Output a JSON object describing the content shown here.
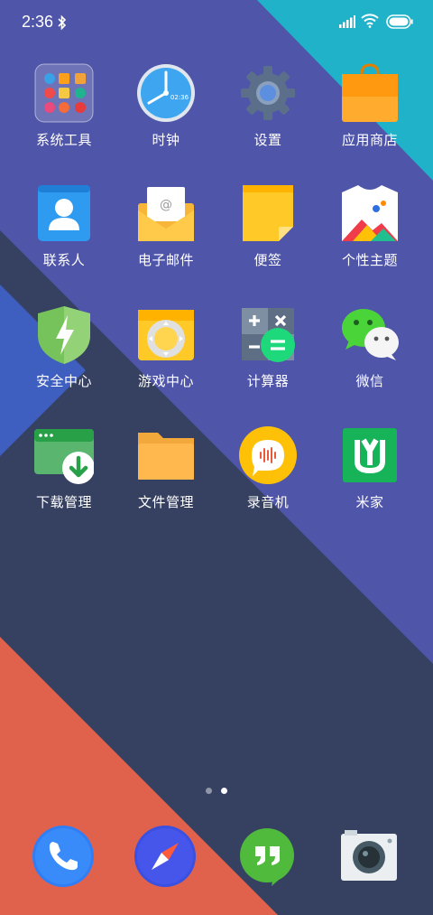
{
  "status_bar": {
    "time": "2:36"
  },
  "apps": [
    {
      "id": "system-tools",
      "label": "系统工具"
    },
    {
      "id": "clock",
      "label": "时钟",
      "clock_text": "02:36"
    },
    {
      "id": "settings",
      "label": "设置"
    },
    {
      "id": "app-store",
      "label": "应用商店"
    },
    {
      "id": "contacts",
      "label": "联系人"
    },
    {
      "id": "email",
      "label": "电子邮件"
    },
    {
      "id": "notes",
      "label": "便签"
    },
    {
      "id": "themes",
      "label": "个性主题"
    },
    {
      "id": "security",
      "label": "安全中心"
    },
    {
      "id": "game-center",
      "label": "游戏中心"
    },
    {
      "id": "calculator",
      "label": "计算器"
    },
    {
      "id": "wechat",
      "label": "微信"
    },
    {
      "id": "downloads",
      "label": "下载管理"
    },
    {
      "id": "file-manager",
      "label": "文件管理"
    },
    {
      "id": "recorder",
      "label": "录音机"
    },
    {
      "id": "mijia",
      "label": "米家"
    }
  ],
  "page_indicator": {
    "pages": 2,
    "current": 2
  },
  "dock": [
    {
      "id": "phone",
      "icon": "phone-icon"
    },
    {
      "id": "browser",
      "icon": "compass-icon"
    },
    {
      "id": "hangouts",
      "icon": "quote-bubble-icon"
    },
    {
      "id": "camera",
      "icon": "camera-icon"
    }
  ],
  "colors": {
    "purple": "#4f55a8",
    "cyan": "#1fb2c8",
    "dark": "#364060",
    "blue": "#3f5fc0",
    "coral": "#e0624d"
  }
}
